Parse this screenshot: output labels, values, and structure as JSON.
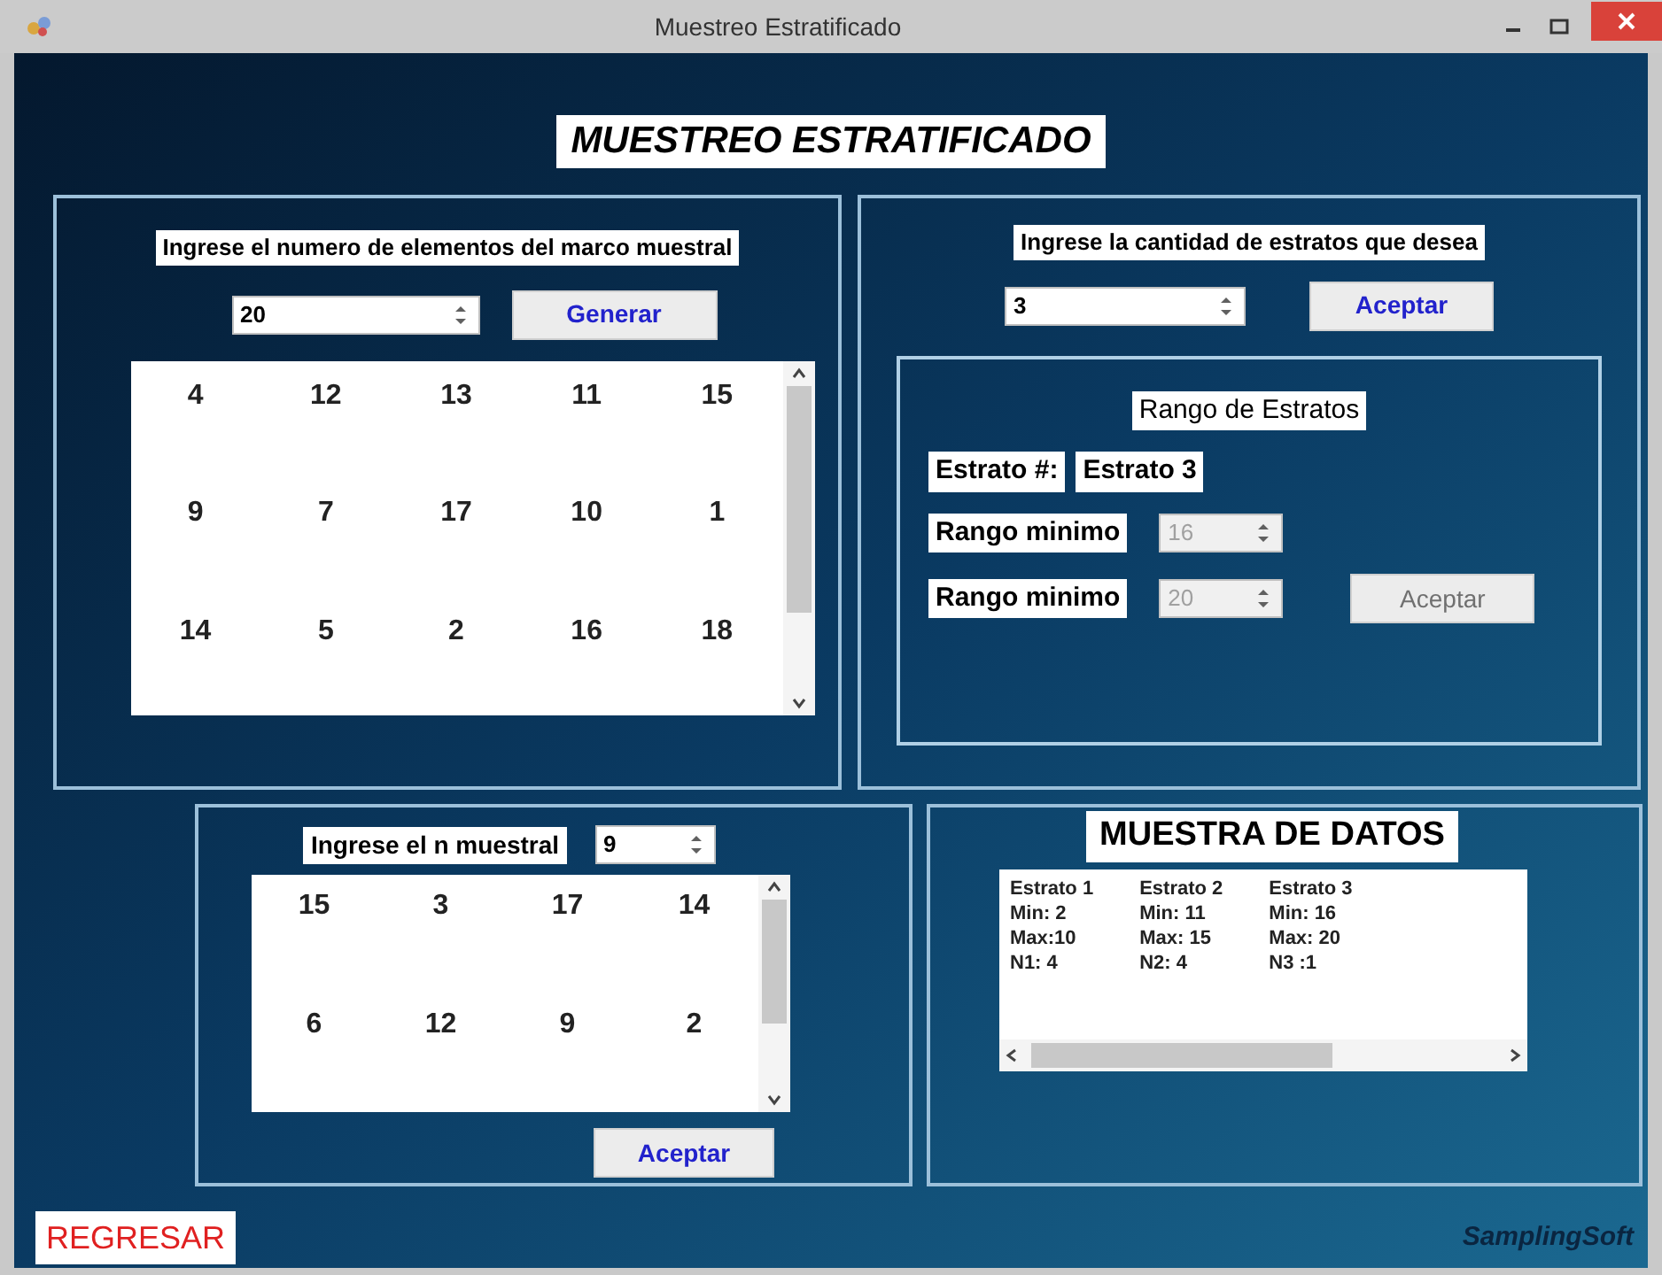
{
  "window": {
    "title": "Muestreo Estratificado"
  },
  "heading": "MUESTREO ESTRATIFICADO",
  "frame_panel": {
    "label": "Ingrese el numero de elementos del marco muestral",
    "spinner": {
      "value": "20",
      "disabled": false
    },
    "button": {
      "label": "Generar",
      "disabled": false
    },
    "rows": [
      [
        "4",
        "12",
        "13",
        "11",
        "15"
      ],
      [
        "9",
        "7",
        "17",
        "10",
        "1"
      ],
      [
        "14",
        "5",
        "2",
        "16",
        "18"
      ]
    ]
  },
  "strata_panel": {
    "label": "Ingrese la cantidad de estratos que desea",
    "spinner": {
      "value": "3",
      "disabled": false
    },
    "button": {
      "label": "Aceptar",
      "disabled": false
    },
    "range_group": {
      "title": "Rango de Estratos",
      "stratum_label": "Estrato #:",
      "stratum_value": "Estrato 3",
      "ranges": [
        {
          "label": "Rango minimo",
          "spinner": {
            "value": "16",
            "disabled": true
          }
        },
        {
          "label": "Rango minimo",
          "spinner": {
            "value": "20",
            "disabled": true
          }
        }
      ],
      "button": {
        "label": "Aceptar",
        "disabled": true
      }
    }
  },
  "sample_panel": {
    "label": "Ingrese el n muestral",
    "spinner": {
      "value": "9",
      "disabled": false
    },
    "rows": [
      [
        "15",
        "3",
        "17",
        "14"
      ],
      [
        "6",
        "12",
        "9",
        "2"
      ]
    ],
    "button": {
      "label": "Aceptar",
      "disabled": false
    }
  },
  "data_panel": {
    "title": "MUESTRA DE DATOS",
    "columns": [
      [
        "Estrato 1",
        "Min: 2",
        "Max:10",
        "N1: 4"
      ],
      [
        "Estrato 2",
        "Min: 11",
        "Max: 15",
        "N2: 4"
      ],
      [
        "Estrato 3",
        "Min: 16",
        "Max: 20",
        "N3 :1"
      ]
    ]
  },
  "back_button": {
    "label": "REGRESAR"
  },
  "brand": "SamplingSoft"
}
